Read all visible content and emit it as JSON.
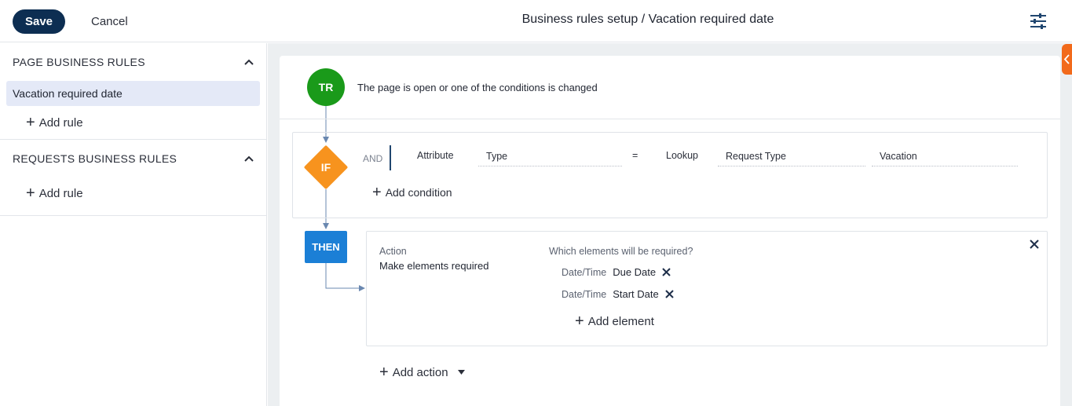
{
  "header": {
    "save_label": "Save",
    "cancel_label": "Cancel",
    "title": "Business rules setup / Vacation required date"
  },
  "sidebar": {
    "sections": [
      {
        "title": "PAGE BUSINESS RULES",
        "items": [
          "Vacation required date"
        ],
        "add_label": "Add rule"
      },
      {
        "title": "REQUESTS BUSINESS RULES",
        "items": [],
        "add_label": "Add rule"
      }
    ]
  },
  "rule": {
    "trigger": {
      "badge": "TR",
      "text": "The page is open or one of the conditions is changed"
    },
    "condition": {
      "badge": "IF",
      "operator": "AND",
      "left_kind": "Attribute",
      "left_value": "Type",
      "comparison": "=",
      "right_kind": "Lookup",
      "right_lookup": "Request Type",
      "right_value": "Vacation",
      "add_label": "Add condition"
    },
    "action": {
      "badge": "THEN",
      "action_label": "Action",
      "action_value": "Make elements required",
      "which_label": "Which elements will be required?",
      "elements": [
        {
          "type": "Date/Time",
          "name": "Due Date"
        },
        {
          "type": "Date/Time",
          "name": "Start Date"
        }
      ],
      "add_element_label": "Add element",
      "add_action_label": "Add action"
    }
  },
  "colors": {
    "save_bg": "#0d2e52",
    "trigger_node": "#1a9a1a",
    "if_node": "#f7931e",
    "then_node": "#1b7fd6",
    "side_tab": "#f26a1b",
    "selected_item_bg": "#e4e9f7"
  },
  "icons": [
    "settings-sliders-icon",
    "chevron-up-icon",
    "plus-icon",
    "close-icon",
    "remove-icon",
    "caret-down-icon",
    "collapse-arrow-icon"
  ]
}
